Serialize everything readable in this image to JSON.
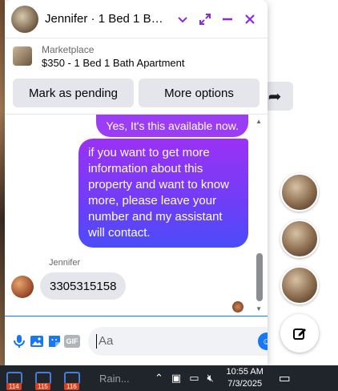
{
  "chat": {
    "title": "Jennifer · 1 Bed 1 Bath ...",
    "listing": {
      "label": "Marketplace",
      "title": "$350 - 1 Bed 1 Bath Apartment"
    },
    "actions": {
      "mark_pending": "Mark as pending",
      "more_options": "More options"
    },
    "messages": {
      "outgoing_short": "Yes, It's this available now.",
      "outgoing_long": "if you want to get more information about this property and want to know more, please leave your number and my assistant will contact.",
      "sender_name": "Jennifer",
      "incoming": "3305315158"
    },
    "composer": {
      "placeholder": "Aa",
      "gif_label": "GIF"
    }
  },
  "taskbar": {
    "apps": [
      {
        "badge": "114"
      },
      {
        "badge": "115"
      },
      {
        "badge": "116"
      }
    ],
    "weather": "Rain...",
    "time": "10:55 AM",
    "date": "7/3/2025"
  },
  "colors": {
    "accent": "#8a2be2",
    "outgoing_bubble_top": "#9b31f5",
    "outgoing_bubble_bottom": "#4b4cf9",
    "messenger_blue": "#1877f2"
  }
}
